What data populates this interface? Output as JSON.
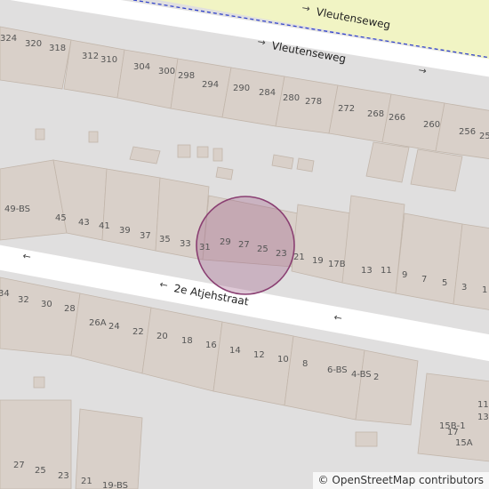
{
  "streets": {
    "vleutenseweg_top": "Vleutenseweg",
    "vleutenseweg": "Vleutenseweg",
    "atjehstraat": "2e Atjehstraat"
  },
  "oneway_arrows": [
    "→",
    "→",
    "→",
    "←",
    "←",
    "←"
  ],
  "house_numbers_north": [
    "324",
    "320",
    "318",
    "312",
    "310",
    "304",
    "300",
    "298",
    "294",
    "290",
    "284",
    "280",
    "278",
    "272",
    "268",
    "266",
    "260",
    "256",
    "25"
  ],
  "house_numbers_middle": [
    "49-BS",
    "45",
    "43",
    "41",
    "39",
    "37",
    "35",
    "33",
    "31",
    "29",
    "27",
    "25",
    "23",
    "21",
    "19",
    "17B",
    "13",
    "11",
    "9",
    "7",
    "5",
    "3",
    "1"
  ],
  "house_numbers_south": [
    "34",
    "32",
    "30",
    "28",
    "26A",
    "24",
    "22",
    "20",
    "18",
    "16",
    "14",
    "12",
    "10",
    "8",
    "6-BS",
    "4-BS",
    "2"
  ],
  "house_numbers_far_south": [
    "27",
    "25",
    "23",
    "21",
    "19-BS",
    "17",
    "15A",
    "15B-1",
    "13",
    "11"
  ],
  "highlight": {
    "label": "selected-address-circle",
    "color": "#a0608a"
  },
  "colors": {
    "background": "#e0dfdf",
    "road": "#ffffff",
    "building": "#d9d0c9",
    "building_outline": "#c2b6ab",
    "cycleway": "#f1f4c4",
    "boundary_dashes": "#3344cc"
  },
  "attribution": {
    "symbol": "©",
    "text": "OpenStreetMap contributors"
  }
}
